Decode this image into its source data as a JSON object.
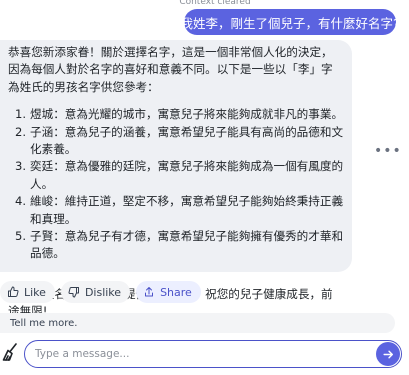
{
  "context_notice": "Context cleared",
  "user_message": "我姓李，剛生了個兒子，有什麼好名字?",
  "assistant": {
    "intro": "恭喜您新添家眷！關於選擇名字，這是一個非常個人化的決定，因為每個人對於名字的喜好和意義不同。以下是一些以「李」字為姓氏的男孩名字供您參考：",
    "names": [
      {
        "num": "1.",
        "text": "煜城：意為光耀的城市，寓意兒子將來能夠成就非凡的事業。"
      },
      {
        "num": "2.",
        "text": "子涵：意為兒子的涵養，寓意希望兒子能具有高尚的品德和文化素養。"
      },
      {
        "num": "3.",
        "text": "奕廷：意為優雅的廷院，寓意兒子將來能夠成為一個有風度的人。"
      },
      {
        "num": "4.",
        "text": "維峻：維持正道，堅定不移，寓意希望兒子能夠始終秉持正義和真理。"
      },
      {
        "num": "5.",
        "text": "子賢：意為兒子有才德，寓意希望兒子能夠擁有優秀的才華和品德。"
      }
    ],
    "outro": "希望這些名字能夠為您提供一些靈感，祝您的兒子健康成長，前途無限!"
  },
  "more_button": "•••",
  "actions": {
    "like": "Like",
    "dislike": "Dislike",
    "share": "Share"
  },
  "suggestion": "Tell me more.",
  "composer": {
    "placeholder": "Type a message..."
  },
  "colors": {
    "accent": "#5b63e0",
    "bubble": "#eef0f4"
  },
  "icons": [
    "thumbs-up-icon",
    "thumbs-down-icon",
    "share-icon",
    "broom-icon",
    "send-arrow-icon",
    "more-icon"
  ]
}
